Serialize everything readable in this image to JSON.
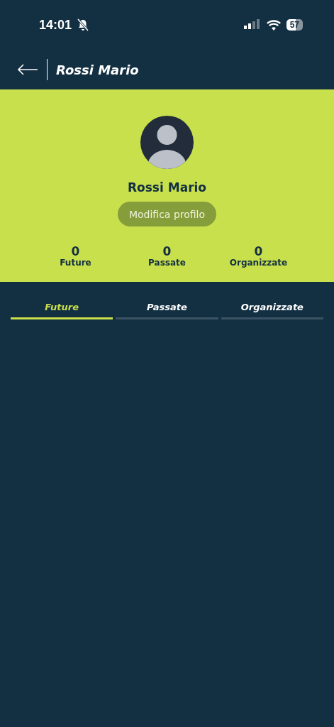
{
  "status_bar": {
    "time": "14:01",
    "battery": "57"
  },
  "header": {
    "title": "Rossi Mario"
  },
  "profile": {
    "name": "Rossi Mario",
    "edit_button": "Modifica profilo"
  },
  "stats": [
    {
      "value": "0",
      "label": "Future"
    },
    {
      "value": "0",
      "label": "Passate"
    },
    {
      "value": "0",
      "label": "Organizzate"
    }
  ],
  "tabs": [
    {
      "label": "Future",
      "selected": true
    },
    {
      "label": "Passate",
      "selected": false
    },
    {
      "label": "Organizzate",
      "selected": false
    }
  ]
}
